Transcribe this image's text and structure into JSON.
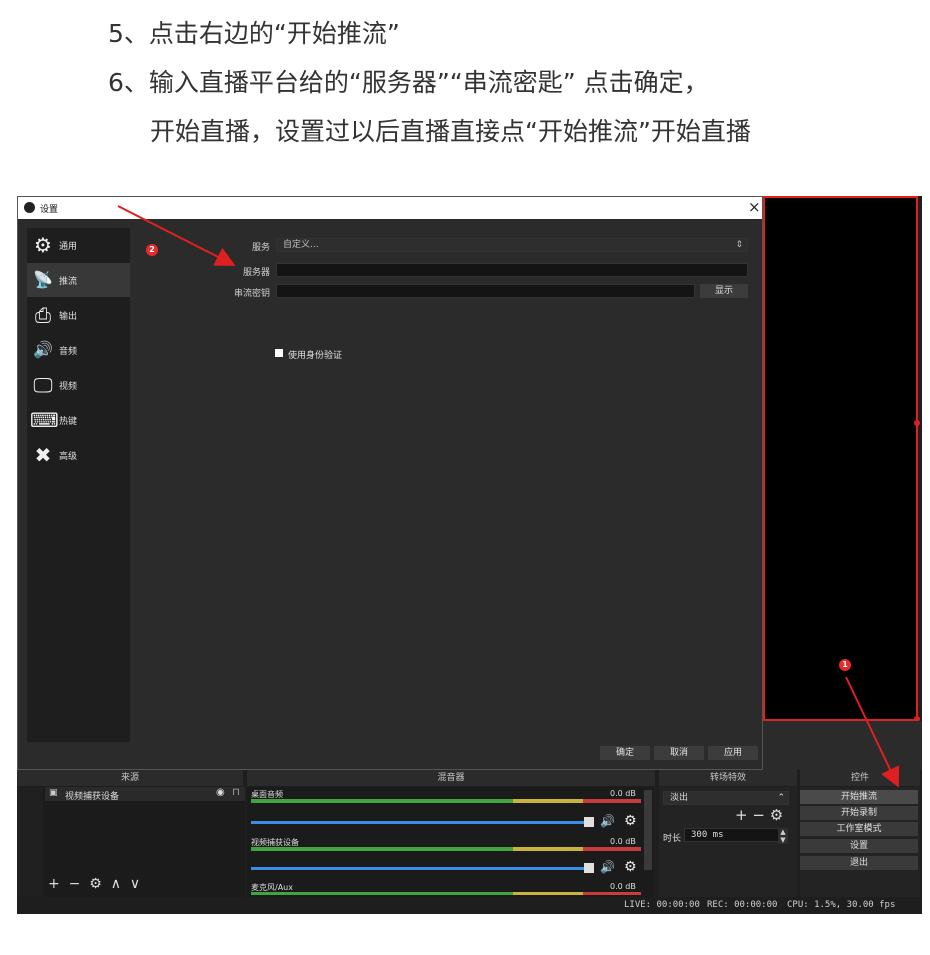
{
  "instructions": {
    "step5": "5、点击右边的“开始推流”",
    "step6_line1": "6、输入直播平台给的“服务器”“串流密匙” 点击确定，",
    "step6_line2": "开始直播，设置过以后直播直接点“开始推流”开始直播"
  },
  "dialog": {
    "title": "设置",
    "close_glyph": "×",
    "sidebar": [
      {
        "label": "通用",
        "icon": "gear-icon",
        "glyph": "⚙"
      },
      {
        "label": "推流",
        "icon": "antenna-icon",
        "glyph": "📡"
      },
      {
        "label": "输出",
        "icon": "output-icon",
        "glyph": "⎙"
      },
      {
        "label": "音频",
        "icon": "speaker-icon",
        "glyph": "🔊"
      },
      {
        "label": "视频",
        "icon": "monitor-icon",
        "glyph": "🖵"
      },
      {
        "label": "热键",
        "icon": "keyboard-icon",
        "glyph": "⌨"
      },
      {
        "label": "高级",
        "icon": "tools-icon",
        "glyph": "✖"
      }
    ],
    "service_label": "服务",
    "service_value": "自定义...",
    "server_label": "服务器",
    "server_value": "",
    "key_label": "串流密钥",
    "key_value": "",
    "show_button": "显示",
    "auth_checkbox": "使用身份验证",
    "ok_button": "确定",
    "cancel_button": "取消",
    "apply_button": "应用"
  },
  "markers": {
    "one": "1",
    "two": "2"
  },
  "docks": {
    "sources_title": "来源",
    "mixer_title": "混音器",
    "transitions_title": "转场特效",
    "controls_title": "控件"
  },
  "sources": {
    "item": "视频捕获设备",
    "toolbar": {
      "add": "+",
      "remove": "−",
      "settings": "⚙",
      "up": "∧",
      "down": "∨"
    }
  },
  "mixer": {
    "channels": [
      {
        "name": "桌面音频",
        "level": "0.0 dB"
      },
      {
        "name": "视频捕获设备",
        "level": "0.0 dB"
      },
      {
        "name": "麦克风/Aux",
        "level": "0.0 dB"
      }
    ]
  },
  "transitions": {
    "type": "淡出",
    "add": "+",
    "remove": "−",
    "settings": "⚙",
    "duration_label": "时长",
    "duration_value": "300 ms"
  },
  "controls": {
    "start_stream": "开始推流",
    "start_record": "开始录制",
    "studio_mode": "工作室模式",
    "settings": "设置",
    "exit": "退出"
  },
  "status": {
    "live": "LIVE: 00:00:00",
    "rec": "REC: 00:00:00",
    "cpu": "CPU: 1.5%, 30.00 fps"
  },
  "colors": {
    "accent_red": "#e02020",
    "vu_green": "#3fa53f",
    "vu_yellow": "#c8b43c",
    "vu_red": "#c83c3c",
    "slider_blue": "#3a8ee6"
  }
}
